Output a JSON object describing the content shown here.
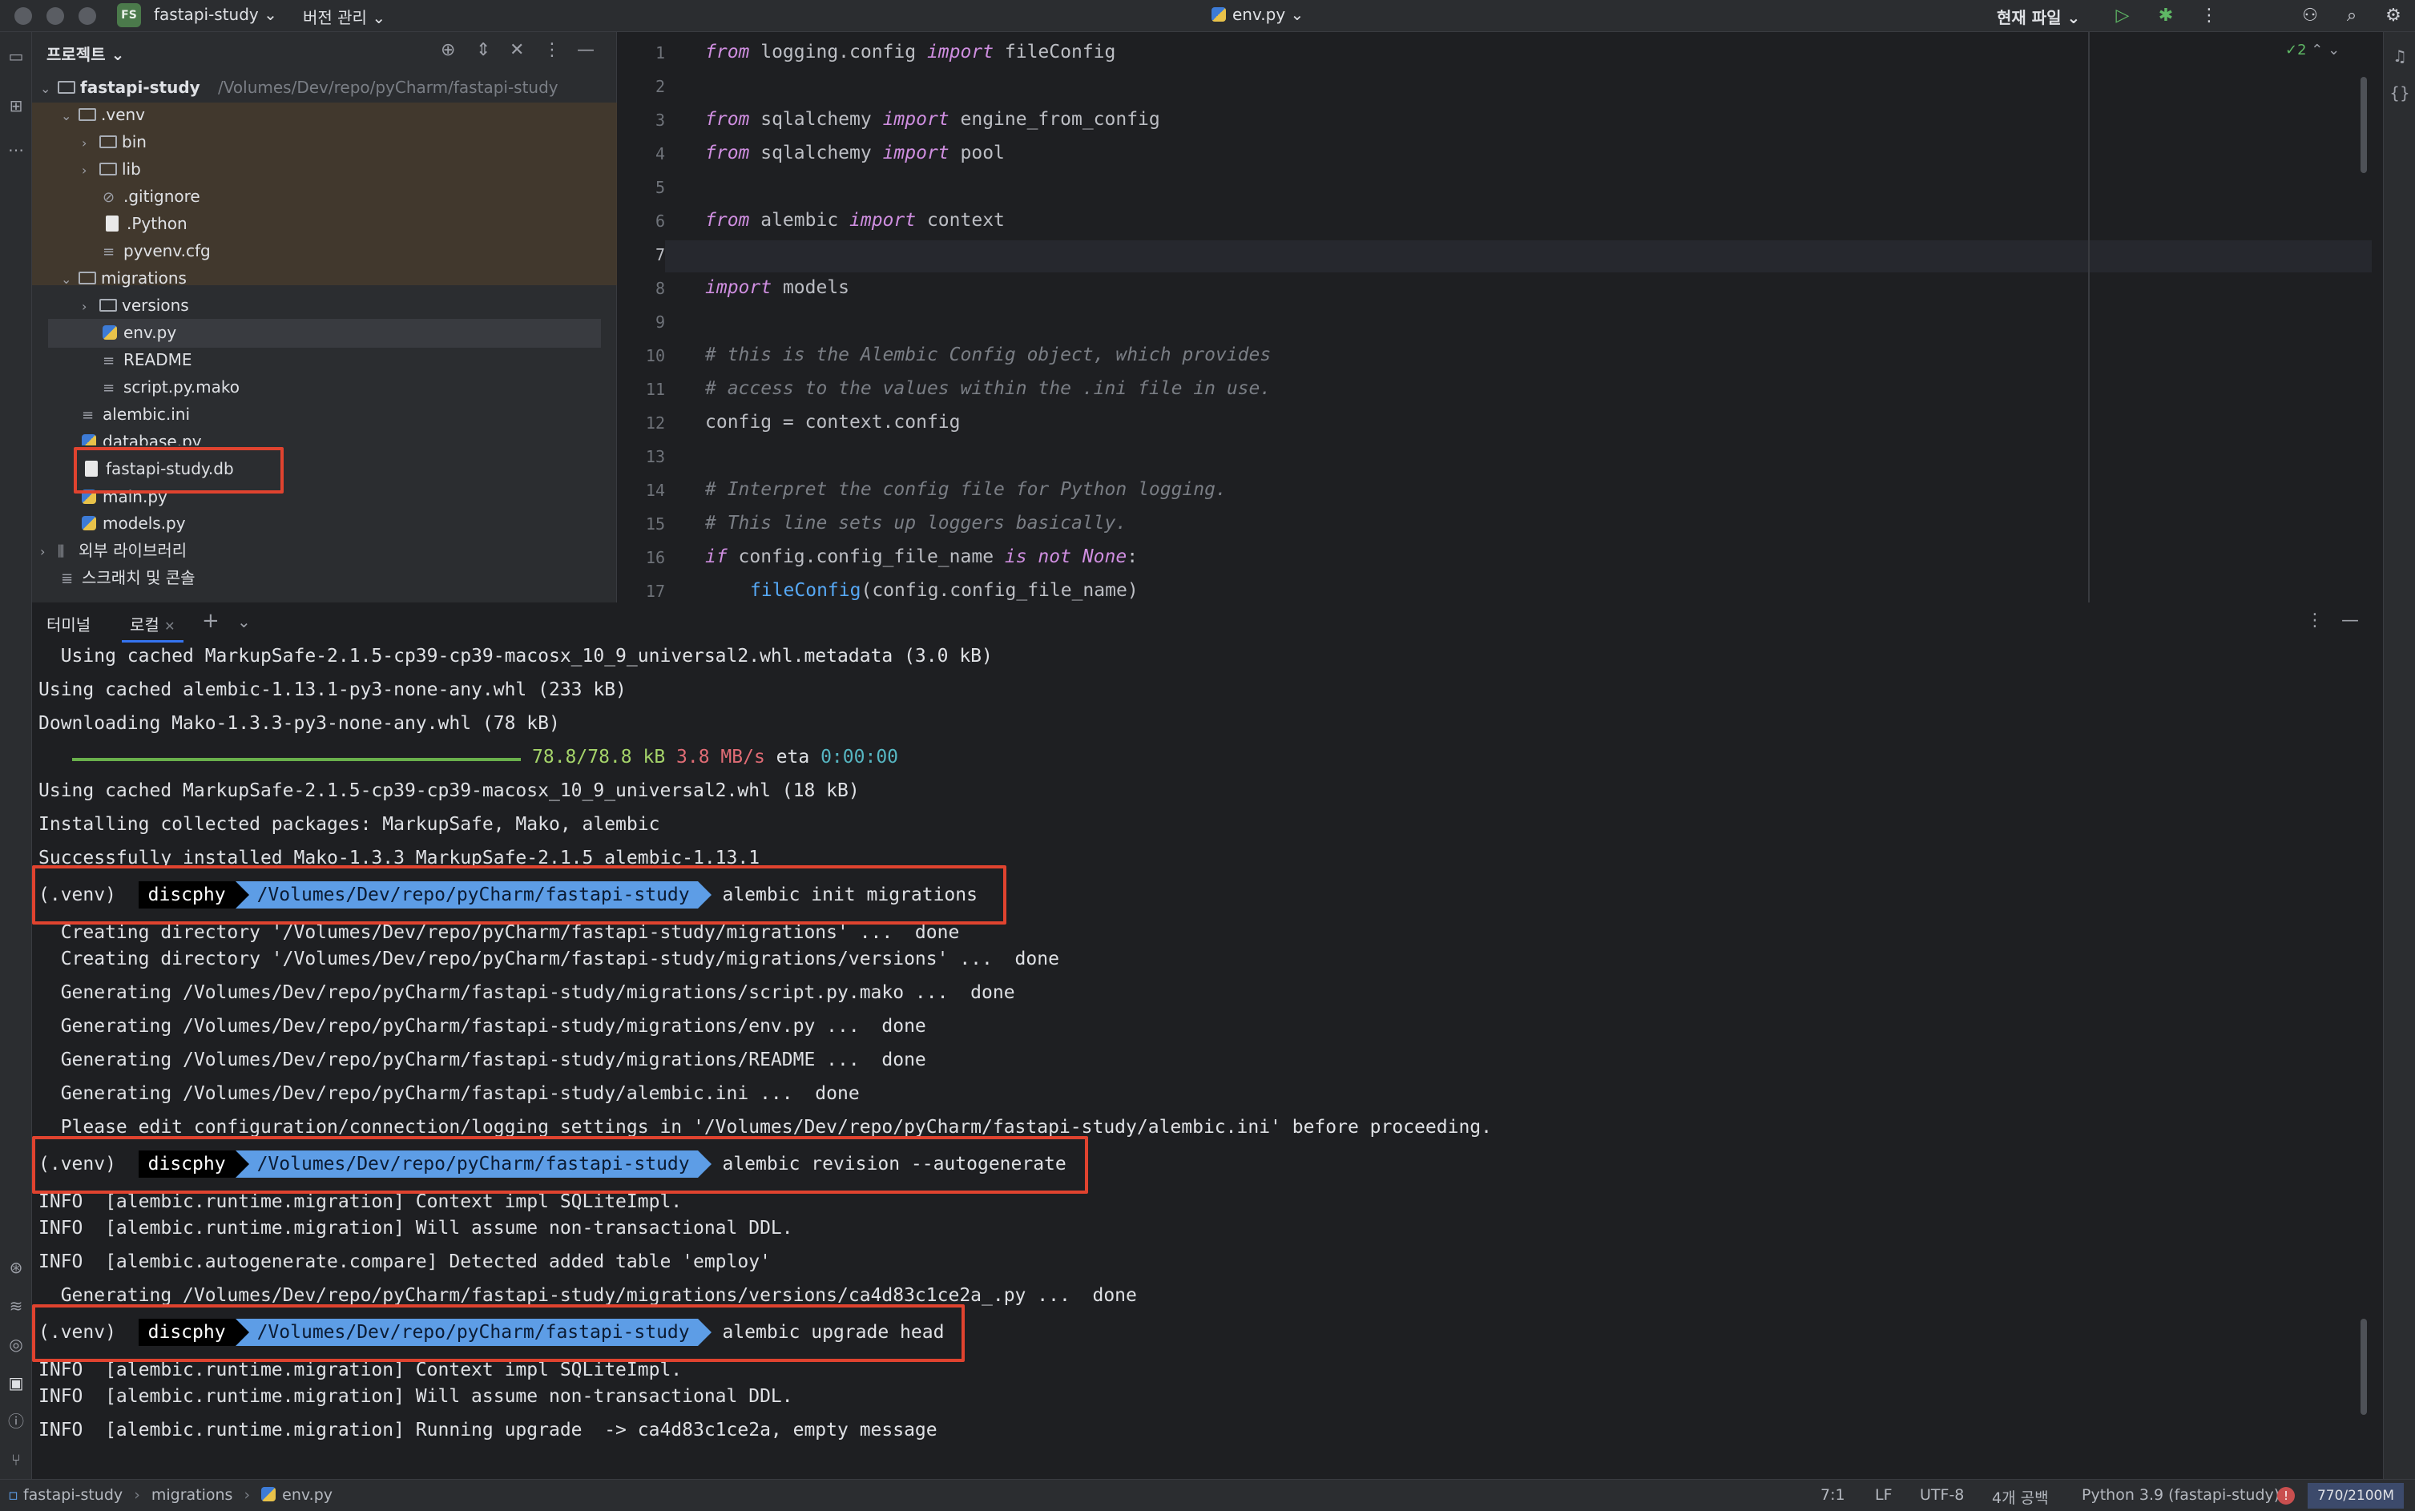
{
  "titlebar": {
    "project_badge": "FS",
    "project_name": "fastapi-study",
    "vcs_menu": "버전 관리",
    "file_tab": "env.py",
    "run_config": "현재 파일"
  },
  "project_panel": {
    "title": "프로젝트",
    "root": {
      "name": "fastapi-study",
      "path": "/Volumes/Dev/repo/pyCharm/fastapi-study"
    },
    "tree": [
      {
        "label": ".venv",
        "type": "folder"
      },
      {
        "label": "bin",
        "type": "folder"
      },
      {
        "label": "lib",
        "type": "folder"
      },
      {
        "label": ".gitignore",
        "type": "ignore"
      },
      {
        "label": ".Python",
        "type": "file"
      },
      {
        "label": "pyvenv.cfg",
        "type": "text"
      },
      {
        "label": "migrations",
        "type": "folder"
      },
      {
        "label": "versions",
        "type": "folder"
      },
      {
        "label": "env.py",
        "type": "python"
      },
      {
        "label": "README",
        "type": "text"
      },
      {
        "label": "script.py.mako",
        "type": "text"
      },
      {
        "label": "alembic.ini",
        "type": "text"
      },
      {
        "label": "database.py",
        "type": "python"
      },
      {
        "label": "fastapi-study.db",
        "type": "file"
      },
      {
        "label": "main.py",
        "type": "python"
      },
      {
        "label": "models.py",
        "type": "python"
      },
      {
        "label": "외부 라이브러리",
        "type": "library"
      },
      {
        "label": "스크래치 및 콘솔",
        "type": "scratch"
      }
    ]
  },
  "editor": {
    "inspection_count": "2",
    "line_numbers": [
      "1",
      "2",
      "3",
      "4",
      "5",
      "6",
      "7",
      "8",
      "9",
      "10",
      "11",
      "12",
      "13",
      "14",
      "15",
      "16",
      "17"
    ],
    "lines": {
      "l1": {
        "kw1": "from",
        "mid": " logging.config ",
        "kw2": "import",
        "rest": " fileConfig"
      },
      "l3": {
        "kw1": "from",
        "mid": " sqlalchemy ",
        "kw2": "import",
        "rest": " engine_from_config"
      },
      "l4": {
        "kw1": "from",
        "mid": " sqlalchemy ",
        "kw2": "import",
        "rest": " pool"
      },
      "l6": {
        "kw1": "from",
        "mid": " alembic ",
        "kw2": "import",
        "rest": " context"
      },
      "l8": {
        "kw1": "import",
        "rest": " models"
      },
      "l10": "# this is the Alembic Config object, which provides",
      "l11": "# access to the values within the .ini file in use.",
      "l12": "config = context.config",
      "l14": "# Interpret the config file for Python logging.",
      "l15": "# This line sets up loggers basically.",
      "l16": {
        "kw1": "if",
        "mid": " config.config_file_name ",
        "kw2": "is not",
        "kw3": " None",
        "rest": ":"
      },
      "l17": {
        "fn": "fileConfig",
        "rest": "(config.config_file_name)"
      }
    }
  },
  "terminal": {
    "tab_terminal": "터미널",
    "tab_local": "로컬",
    "lines": {
      "t1": "  Using cached MarkupSafe-2.1.5-cp39-cp39-macosx_10_9_universal2.whl.metadata (3.0 kB)",
      "t2": "Using cached alembic-1.13.1-py3-none-any.whl (233 kB)",
      "t3": "Downloading Mako-1.3.3-py3-none-any.whl (78 kB)",
      "t4_size": "78.8/78.8 kB",
      "t4_speed": "3.8 MB/s",
      "t4_eta_label": "eta",
      "t4_eta": "0:00:00",
      "t5": "Using cached MarkupSafe-2.1.5-cp39-cp39-macosx_10_9_universal2.whl (18 kB)",
      "t6": "Installing collected packages: MarkupSafe, Mako, alembic",
      "t7": "Successfully installed Mako-1.3.3 MarkupSafe-2.1.5 alembic-1.13.1",
      "t9": "  Creating directory '/Volumes/Dev/repo/pyCharm/fastapi-study/migrations' ...  done",
      "t10": "  Creating directory '/Volumes/Dev/repo/pyCharm/fastapi-study/migrations/versions' ...  done",
      "t11": "  Generating /Volumes/Dev/repo/pyCharm/fastapi-study/migrations/script.py.mako ...  done",
      "t12": "  Generating /Volumes/Dev/repo/pyCharm/fastapi-study/migrations/env.py ...  done",
      "t13": "  Generating /Volumes/Dev/repo/pyCharm/fastapi-study/migrations/README ...  done",
      "t14": "  Generating /Volumes/Dev/repo/pyCharm/fastapi-study/alembic.ini ...  done",
      "t15": "  Please edit configuration/connection/logging settings in '/Volumes/Dev/repo/pyCharm/fastapi-study/alembic.ini' before proceeding.",
      "t17": "INFO  [alembic.runtime.migration] Context impl SQLiteImpl.",
      "t18": "INFO  [alembic.runtime.migration] Will assume non-transactional DDL.",
      "t19": "INFO  [alembic.autogenerate.compare] Detected added table 'employ'",
      "t20": "  Generating /Volumes/Dev/repo/pyCharm/fastapi-study/migrations/versions/ca4d83c1ce2a_.py ...  done",
      "t22": "INFO  [alembic.runtime.migration] Context impl SQLiteImpl.",
      "t23": "INFO  [alembic.runtime.migration] Will assume non-transactional DDL.",
      "t24": "INFO  [alembic.runtime.migration] Running upgrade  -> ca4d83c1ce2a, empty message"
    },
    "prompt": {
      "venv": "(.venv)",
      "user": "discphy",
      "path": "/Volumes/Dev/repo/pyCharm/fastapi-study"
    },
    "commands": [
      "alembic init migrations",
      "alembic revision --autogenerate",
      "alembic upgrade head"
    ]
  },
  "statusbar": {
    "crumb_root": "fastapi-study",
    "crumb_folder": "migrations",
    "crumb_file": "env.py",
    "position": "7:1",
    "line_ending": "LF",
    "encoding": "UTF-8",
    "indent": "4개 공백",
    "interpreter": "Python 3.9 (fastapi-study)",
    "memory": "770/2100M"
  },
  "colors": {
    "highlight_box": "#e0432f",
    "prompt_path_bg": "#5d9de6",
    "keyword": "#cf8ee0"
  },
  "icons": [
    "folder-icon",
    "python-file-icon",
    "search-icon",
    "settings-icon",
    "run-icon",
    "debug-icon",
    "bell-icon",
    "terminal-icon",
    "git-icon"
  ]
}
